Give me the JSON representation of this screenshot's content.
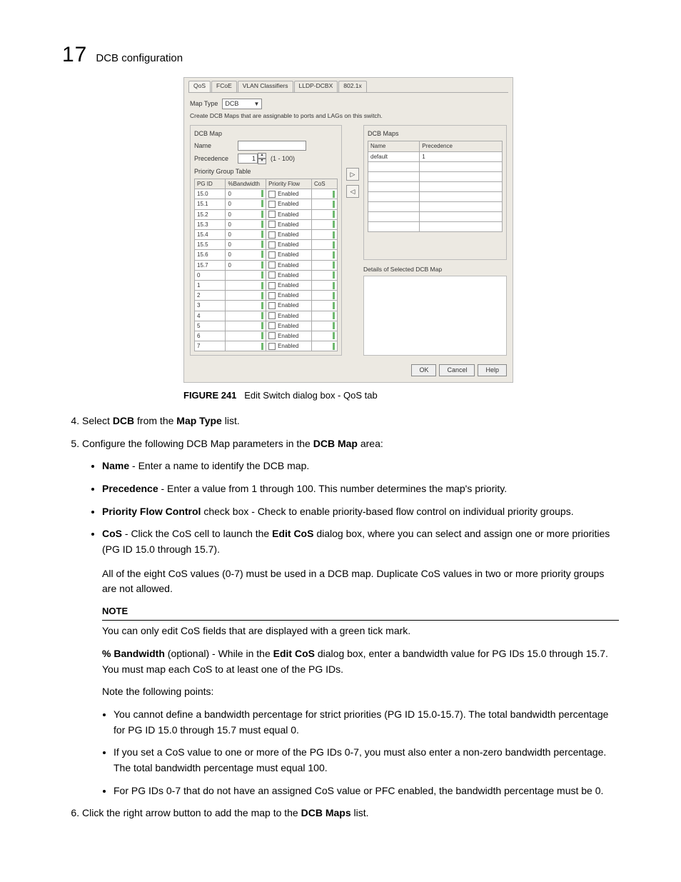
{
  "chapter_num": "17",
  "chapter_title": "DCB configuration",
  "dialog": {
    "tabs": [
      "QoS",
      "FCoE",
      "VLAN Classifiers",
      "LLDP-DCBX",
      "802.1x"
    ],
    "map_type_label": "Map Type",
    "map_type_value": "DCB",
    "caption": "Create DCB Maps that are assignable to ports and LAGs on this switch.",
    "left_panel_title": "DCB Map",
    "name_label": "Name",
    "precedence_label": "Precedence",
    "precedence_value": "1",
    "precedence_range": "(1 - 100)",
    "pgt_label": "Priority Group Table",
    "cols": {
      "c1": "PG ID",
      "c2": "%Bandwidth",
      "c3": "Priority Flow",
      "c4": "CoS"
    },
    "rows": [
      {
        "id": "15.0",
        "bw": "0",
        "pf": "Enabled"
      },
      {
        "id": "15.1",
        "bw": "0",
        "pf": "Enabled"
      },
      {
        "id": "15.2",
        "bw": "0",
        "pf": "Enabled"
      },
      {
        "id": "15.3",
        "bw": "0",
        "pf": "Enabled"
      },
      {
        "id": "15.4",
        "bw": "0",
        "pf": "Enabled"
      },
      {
        "id": "15.5",
        "bw": "0",
        "pf": "Enabled"
      },
      {
        "id": "15.6",
        "bw": "0",
        "pf": "Enabled"
      },
      {
        "id": "15.7",
        "bw": "0",
        "pf": "Enabled"
      },
      {
        "id": "0",
        "bw": "",
        "pf": "Enabled"
      },
      {
        "id": "1",
        "bw": "",
        "pf": "Enabled"
      },
      {
        "id": "2",
        "bw": "",
        "pf": "Enabled"
      },
      {
        "id": "3",
        "bw": "",
        "pf": "Enabled"
      },
      {
        "id": "4",
        "bw": "",
        "pf": "Enabled"
      },
      {
        "id": "5",
        "bw": "",
        "pf": "Enabled"
      },
      {
        "id": "6",
        "bw": "",
        "pf": "Enabled"
      },
      {
        "id": "7",
        "bw": "",
        "pf": "Enabled"
      }
    ],
    "right_panel_title": "DCB Maps",
    "maps_cols": {
      "c1": "Name",
      "c2": "Precedence"
    },
    "maps_rows": [
      {
        "n": "default",
        "p": "1"
      }
    ],
    "details_title": "Details of Selected DCB Map",
    "btn_ok": "OK",
    "btn_cancel": "Cancel",
    "btn_help": "Help"
  },
  "figure_num": "FIGURE 241",
  "figure_caption": "Edit Switch dialog box - QoS tab",
  "step4_pre": "Select ",
  "step4_b1": "DCB",
  "step4_mid": " from the ",
  "step4_b2": "Map Type",
  "step4_post": " list.",
  "step5_pre": "Configure the following DCB Map parameters in the ",
  "step5_b": "DCB Map",
  "step5_post": " area:",
  "b1_name": "Name",
  "b1_text": " - Enter a name to identify the DCB map.",
  "b2_name": "Precedence",
  "b2_text": " - Enter a value from 1 through 100. This number determines the map's priority.",
  "b3_name": "Priority Flow Control",
  "b3_text": " check box - Check to enable priority-based flow control on individual priority groups.",
  "b4_name": "CoS",
  "b4_mid": " - Click the CoS cell to launch the ",
  "b4_b2": "Edit CoS",
  "b4_post": " dialog box, where you can select and assign one or more priorities (PG ID 15.0 through 15.7).",
  "cos_para": "All of the eight CoS values (0-7) must be used in a DCB map. Duplicate CoS values in two or more priority groups are not allowed.",
  "note_h": "NOTE",
  "note_body": "You can only edit CoS fields that are displayed with a green tick mark.",
  "bw_b1": "% Bandwidth",
  "bw_mid": " (optional) - While in the ",
  "bw_b2": "Edit CoS",
  "bw_post": " dialog box, enter a bandwidth value for PG IDs 15.0 through 15.7. You must map each CoS to at least one of the PG IDs.",
  "note_pts": "Note the following points:",
  "nb1": "You cannot define a bandwidth percentage for strict priorities (PG ID 15.0-15.7). The total bandwidth percentage for PG ID 15.0 through 15.7 must equal 0.",
  "nb2": "If you set a CoS value to one or more of the PG IDs 0-7, you must also enter a non-zero bandwidth percentage. The total bandwidth percentage must equal 100.",
  "nb3": "For PG IDs 0-7 that do not have an assigned CoS value or PFC enabled, the bandwidth percentage must be 0.",
  "step6_pre": "Click the right arrow button to add the map to the ",
  "step6_b": "DCB Maps",
  "step6_post": " list."
}
